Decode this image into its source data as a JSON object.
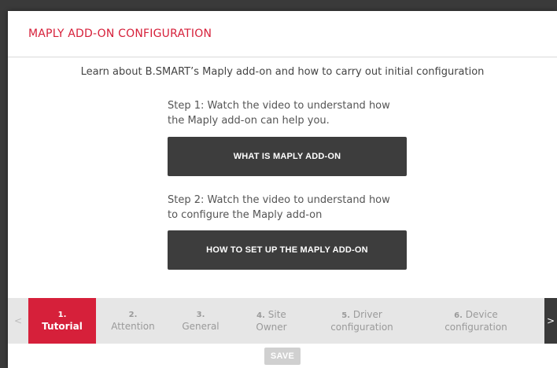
{
  "modal": {
    "title": "MAPLY ADD-ON CONFIGURATION",
    "intro": "Learn about B.SMART’s Maply add-on and how to carry out initial configuration"
  },
  "steps_content": [
    {
      "line1": "Step 1: Watch the video to understand how",
      "line2": "the Maply add-on can help you.",
      "button": "WHAT IS MAPLY ADD-ON"
    },
    {
      "line1": "Step 2: Watch the video to understand how",
      "line2": "to configure the Maply add-on",
      "button": "HOW TO SET UP THE MAPLY ADD-ON"
    }
  ],
  "stepper": {
    "prev_icon": "<",
    "next_icon": ">",
    "items": [
      {
        "num": "1.",
        "label": "Tutorial",
        "active": true
      },
      {
        "num": "2.",
        "label": "Attention"
      },
      {
        "num": "3.",
        "label": "General"
      },
      {
        "num": "4.",
        "label_line1": "Site",
        "label_line2": "Owner"
      },
      {
        "num": "5.",
        "label_line1": "Driver",
        "label_line2": "configuration"
      },
      {
        "num": "6.",
        "label_line1": "Device",
        "label_line2": "configuration"
      }
    ]
  },
  "footer": {
    "save_label": "SAVE"
  },
  "colors": {
    "accent": "#d6203a",
    "button_dark": "#3d3d3d"
  }
}
